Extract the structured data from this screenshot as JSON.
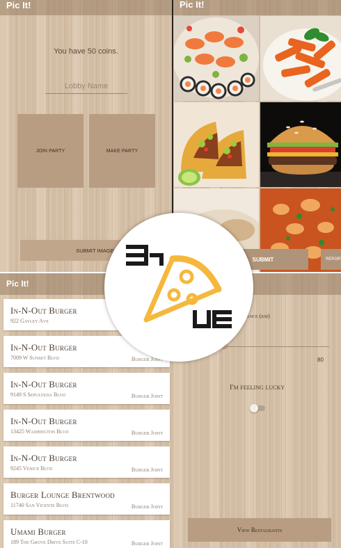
{
  "screen1": {
    "app_title": "Pic It!",
    "coins_text": "You have 50 coins.",
    "lobby_placeholder": "Lobby Name",
    "join_label": "Join Party",
    "make_label": "Make Party",
    "submit_image_label": "Submit Image"
  },
  "screen2": {
    "app_title": "Pic It!",
    "foods": [
      "sushi-platter-image",
      "pasta-image",
      "tacos-image",
      "burger-image",
      "dessert-image",
      "curry-image"
    ],
    "submit_label": "Submit",
    "report_label": "Report"
  },
  "screen3": {
    "app_title": "Pic It!",
    "restaurants": [
      {
        "name": "In-N-Out Burger",
        "address": "922 Gayley Ave",
        "type": ""
      },
      {
        "name": "In-N-Out Burger",
        "address": "7009 W Sunset Blvd",
        "type": "Burger Joint"
      },
      {
        "name": "In-N-Out Burger",
        "address": "9149 S Sepulveda Blvd",
        "type": "Burger Joint"
      },
      {
        "name": "In-N-Out Burger",
        "address": "13425 Washington Blvd",
        "type": "Burger Joint"
      },
      {
        "name": "In-N-Out Burger",
        "address": "9245 Venice Blvd",
        "type": "Burger Joint"
      },
      {
        "name": "Burger Lounge Brentwood",
        "address": "11740 San Vicente Blvd",
        "type": "Burger Joint"
      },
      {
        "name": "Umami Burger",
        "address": "189 The Grove Drive Suite C-10",
        "type": "Burger Joint"
      }
    ]
  },
  "screen4": {
    "max_distance_label": "Distance (km)",
    "slider_value": "80",
    "lucky_label": "I'm feeling lucky",
    "toggle_on": false,
    "view_label": "View Restaurants"
  },
  "logo": {
    "icon": "pizza-slice-icon",
    "colors": {
      "accent": "#f5b83d",
      "dark": "#1a1a1a"
    }
  }
}
